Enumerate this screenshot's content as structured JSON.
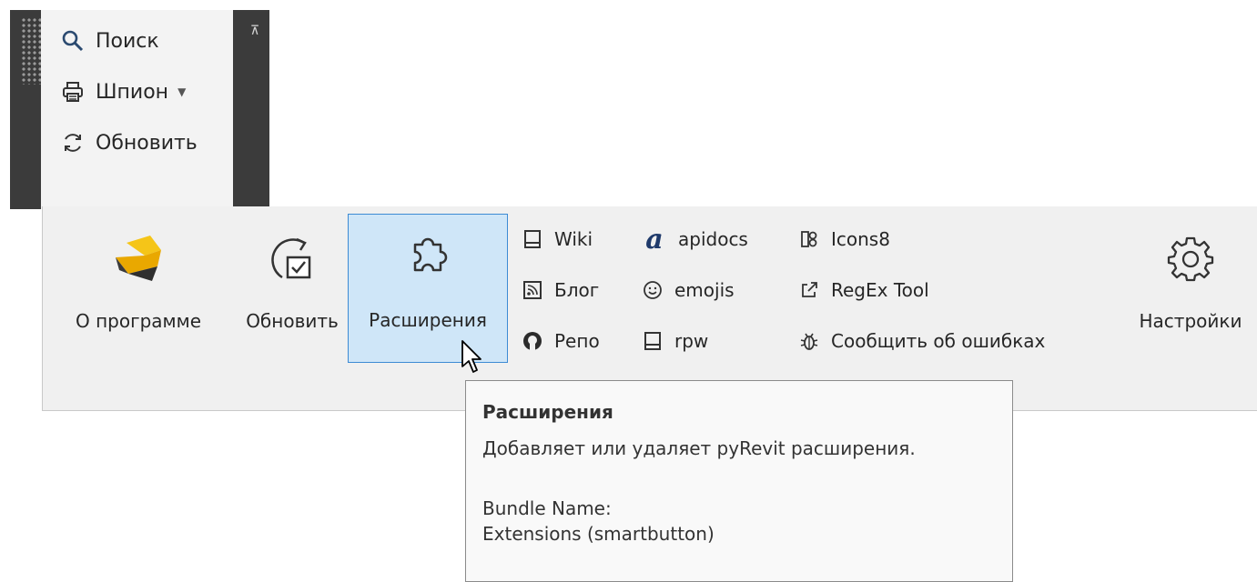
{
  "panel": {
    "collapse_glyph": "⊼",
    "items": [
      {
        "label": "Поиск",
        "icon": "search-icon"
      },
      {
        "label": "Шпион",
        "icon": "printer-icon",
        "has_dropdown": true
      },
      {
        "label": "Обновить",
        "icon": "refresh-icon"
      }
    ]
  },
  "ribbon": {
    "about_label": "О программе",
    "update_label": "Обновить",
    "extensions_label": "Расширения",
    "settings_label": "Настройки",
    "links": {
      "col1": [
        {
          "label": "Wiki",
          "icon": "book-icon"
        },
        {
          "label": "Блог",
          "icon": "rss-icon"
        },
        {
          "label": "Репо",
          "icon": "github-icon"
        }
      ],
      "col2": [
        {
          "label": "apidocs",
          "icon": "apidocs-a-icon"
        },
        {
          "label": "emojis",
          "icon": "smiley-icon"
        },
        {
          "label": "rpw",
          "icon": "book-icon"
        }
      ],
      "col3": [
        {
          "label": "Icons8",
          "icon": "icons8-icon"
        },
        {
          "label": "RegEx Tool",
          "icon": "external-link-icon"
        },
        {
          "label": "Сообщить об ошибках",
          "icon": "bug-icon"
        }
      ]
    },
    "accent_color": "#3d8bd4",
    "hover_bg": "#cfe6f8",
    "logo_color": "#f5c518"
  },
  "tooltip": {
    "title": "Расширения",
    "description": "Добавляет или удаляет pyRevit расширения.",
    "bundle_label": "Bundle Name:",
    "bundle_value": "Extensions (smartbutton)"
  }
}
